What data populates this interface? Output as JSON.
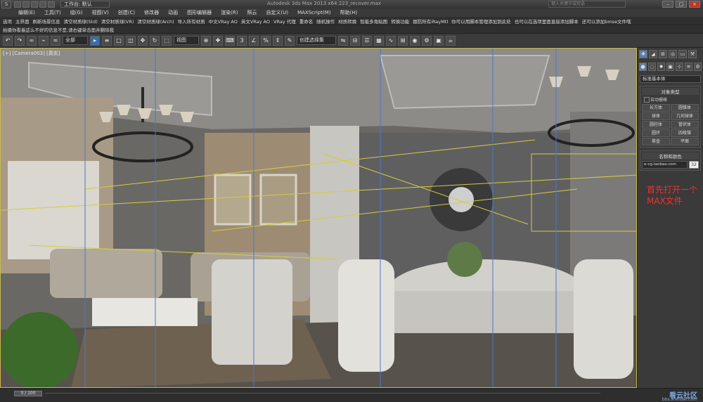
{
  "titlebar": {
    "workspace": "工作台: 默认",
    "app_title": "Autodesk 3ds Max 2013 x64   223_recover.max",
    "search_placeholder": "键入关键字或短语"
  },
  "menu": [
    "编辑(E)",
    "工具(T)",
    "组(G)",
    "视图(V)",
    "创建(C)",
    "修改器",
    "动画",
    "图形编辑器",
    "渲染(R)",
    "照云",
    "自定义(U)",
    "MAXScript(M)",
    "帮助(H)"
  ],
  "command_row1": [
    "选项",
    "主界面",
    "刷新场景信息",
    "清空材质球(Std)",
    "清空材质球(VR)",
    "清空材质球(Arch)",
    "导入所有材质",
    "中文VRay AO",
    "英文VRay AO",
    "VRay 代理",
    "重命名",
    "随机操作",
    "材质转换",
    "智能多角贴图",
    "转换功能",
    "摁防所有iRayMtl",
    "你可以用脚本管理添加到此处",
    "也可以在选项里面直接添加脚本",
    "还可以添加bmse文件哦"
  ],
  "command_row2": "拍摄你看着这么不好的信息不是,请右键单击面并删除我",
  "toolbar": {
    "selection_filter": "全部",
    "ref_coord": "视图",
    "named_selection": "创建选择集"
  },
  "viewport": {
    "label": "[+] [Camera003] [真实]"
  },
  "overlay_text": "首先打开一个MAX文件",
  "command_panel": {
    "category": "标准基本体",
    "object_type_title": "对象类型",
    "autogrid": "自动栅格",
    "primitives": [
      "长方体",
      "圆锥体",
      "球体",
      "几何球体",
      "圆柱体",
      "管状体",
      "圆环",
      "四棱锥",
      "茶壶",
      "平面"
    ],
    "name_color_title": "名称和颜色",
    "name_value": "e-cg.taobao.com",
    "color_value": "32"
  },
  "timeline": {
    "frame": "0 / 100"
  },
  "watermark": {
    "site": "看云社区",
    "url": "bbs.xrender.com"
  }
}
